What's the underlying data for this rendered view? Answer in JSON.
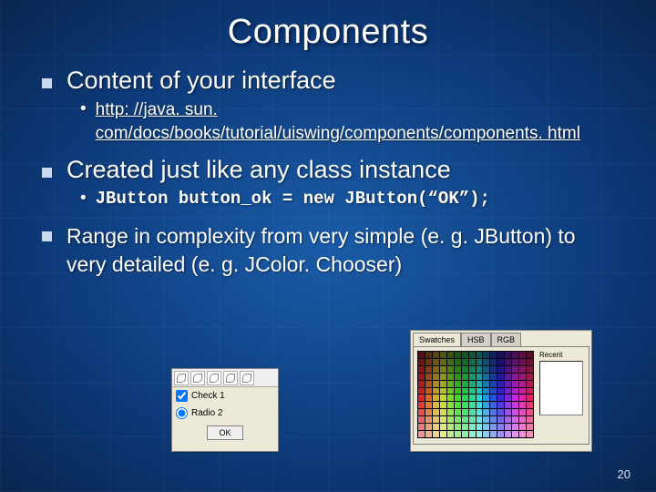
{
  "title": "Components",
  "points": [
    {
      "text": "Content of your interface",
      "sub": [
        {
          "type": "link",
          "text": "http: //java. sun. com/docs/books/tutorial/uiswing/components/components. html"
        }
      ]
    },
    {
      "text": "Created just like any class instance",
      "sub": [
        {
          "type": "code",
          "text": "JButton button_ok = new JButton(“OK”);"
        }
      ]
    },
    {
      "text": "Range in complexity from very simple (e. g. JButton) to very detailed (e. g. JColor. Chooser)"
    }
  ],
  "panel1": {
    "check_label": "Check 1",
    "radio_label": "Radio 2",
    "ok": "OK"
  },
  "panel2": {
    "tab1": "Swatches",
    "tab2": "HSB",
    "tab3": "RGB",
    "recent_label": "Recent"
  },
  "slide_number": "20"
}
